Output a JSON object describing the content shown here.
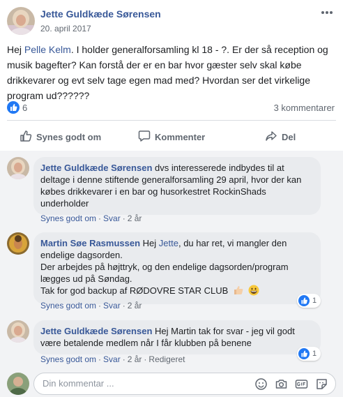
{
  "post": {
    "author": "Jette Guldkæde Sørensen",
    "date": "20. april 2017",
    "body_prefix": "Hej ",
    "body_mention": "Pelle Kelm",
    "body_rest": ". I holder generalforsamling kl 18 - ?. Er der så reception og musik bagefter? Kan forstå der er en bar hvor gæster selv skal købe drikkevarer og evt selv tage egen mad med? Hvordan ser det virkelige program ud??????",
    "reaction_count": "6",
    "comment_count": "3 kommentarer"
  },
  "actions": {
    "like": "Synes godt om",
    "comment": "Kommenter",
    "share": "Del"
  },
  "comments": [
    {
      "author": "Jette Guldkæde Sørensen",
      "text": " dvs interesserede indbydes til at deltage i denne stiftende generalforsamling 29 april, hvor der kan købes drikkevarer i en bar og husorkestret RockinShads underholder",
      "like": "Synes godt om",
      "reply": "Svar",
      "time": "2 år"
    },
    {
      "author": "Martin Søe Rasmussen",
      "text_prefix": " Hej ",
      "mention": "Jette",
      "text_rest": ", du har ret, vi mangler den endelige dagsorden.",
      "line2": "Der arbejdes på højttryk, og den endelige dagsorden/program lægges ud på Søndag.",
      "line3": "Tak for god backup af RØDOVRE STAR CLUB",
      "like": "Synes godt om",
      "reply": "Svar",
      "time": "2 år",
      "reactions": "1"
    },
    {
      "author": "Jette Guldkæde Sørensen",
      "text": " Hej Martin tak for svar - jeg vil godt være betalende medlem når I får klubben på benene",
      "like": "Synes godt om",
      "reply": "Svar",
      "time": "2 år",
      "edited": "Redigeret",
      "reactions": "1"
    }
  ],
  "composer": {
    "placeholder": "Din kommentar ..."
  },
  "colors": {
    "link": "#385898",
    "like_blue": "#2078f4",
    "meta_gray": "#606770",
    "bubble": "#e9ebee",
    "comments_bg": "#f2f3f5"
  },
  "icons": [
    "more-icon",
    "like-reaction-icon",
    "thumbs-up-icon",
    "comment-icon",
    "share-icon",
    "thumbs-up-emoji",
    "grinning-emoji",
    "emoji-icon",
    "camera-icon",
    "gif-icon",
    "sticker-icon"
  ]
}
